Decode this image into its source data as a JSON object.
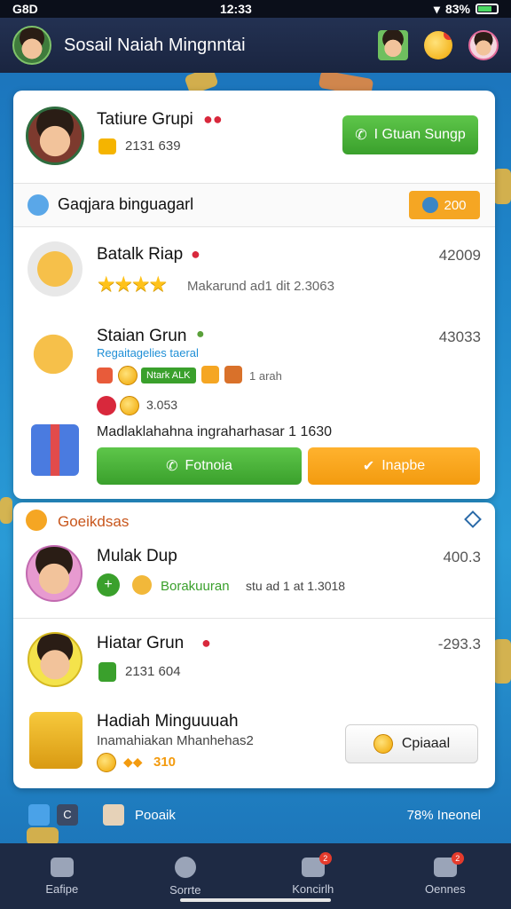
{
  "status_bar": {
    "left": "G8D",
    "time": "12:33",
    "battery": "83%"
  },
  "header": {
    "title": "Sosail Naiah Mingnntai"
  },
  "card1": {
    "profile_name": "Tatiure Grupi",
    "profile_sub": "2131 639",
    "action_label": "I Gtuan Sungp",
    "section_title": "Gaqjara binguagarl",
    "section_badge": "200"
  },
  "list1": [
    {
      "name": "Batalk Riap",
      "detail": "Makarund ad1 dit 2.3063",
      "score": "42009",
      "stars": 4
    },
    {
      "name": "Staian Grun",
      "detail": "Regaitagelies taeral",
      "chip": "Ntark ALK",
      "extra": "1 arah",
      "counter": "3.053",
      "score": "43033"
    },
    {
      "name": "Madlaklahahnа ingraharhasar 1 1630"
    }
  ],
  "buttons": {
    "left": "Fotnoia",
    "right": "Inapbe"
  },
  "card2": {
    "section_title": "Goeikdsas",
    "rows": [
      {
        "name": "Mulak Dup",
        "detail_green": "Borakuuran",
        "detail_rest": "stu ad 1 at 1.3018",
        "score": "400.3"
      },
      {
        "name": "Hiatar Grun",
        "sub": "2131 604",
        "score": "-293.3"
      },
      {
        "name": "Hadiah Minguuuah",
        "sub": "Inamahiakan Mhanhehas2",
        "coins": "310",
        "action": "Cpiaaal"
      }
    ]
  },
  "footer_strip": {
    "left_label": "Pooaik",
    "right_label": "78% Ineonel"
  },
  "nav": [
    {
      "label": "Eafipe"
    },
    {
      "label": "Sorrte"
    },
    {
      "label": "Koncirlh",
      "badge": "2"
    },
    {
      "label": "Oennes",
      "badge": "2"
    }
  ],
  "colors": {
    "green": "#3aa02c",
    "orange": "#f39b0f",
    "header": "#233152"
  }
}
